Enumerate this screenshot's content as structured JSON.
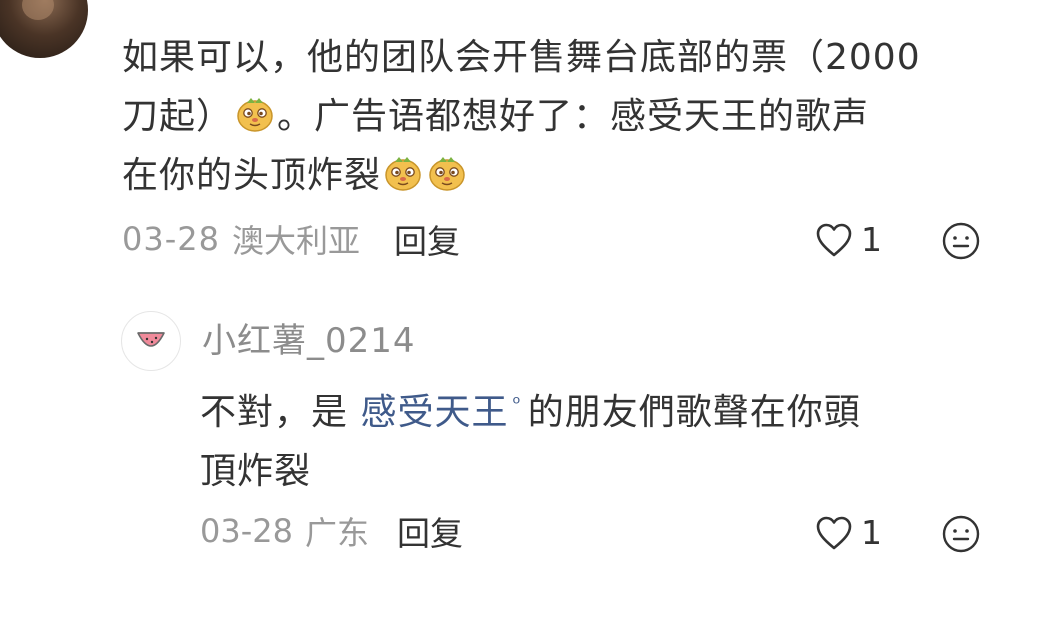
{
  "main_comment": {
    "lines": [
      "如果可以，他的团队会开售舞台底部的票（2000",
      "刀起）",
      "。广告语都想好了：感受天王的歌声",
      "在你的头顶炸裂"
    ],
    "emoji_name": "doge-emoji",
    "date": "03-28",
    "location": "澳大利亚",
    "reply_label": "回复",
    "like_count": "1"
  },
  "reply_comment": {
    "username": "小红薯_0214",
    "text_before_link": "不對，是 ",
    "link_text": "感受天王",
    "link_suffix_icon": "search-icon",
    "link_suffix_char": "ᵒ",
    "text_after_link": "的朋友們歌聲在你頭",
    "text_line2": "頂炸裂",
    "date": "03-28",
    "location": "广东",
    "reply_label": "回复",
    "like_count": "1"
  },
  "colors": {
    "text": "#333333",
    "meta": "#999999",
    "username": "#8c8c8c",
    "link": "#3f5a8a",
    "emoji_body": "#f2c04e"
  }
}
